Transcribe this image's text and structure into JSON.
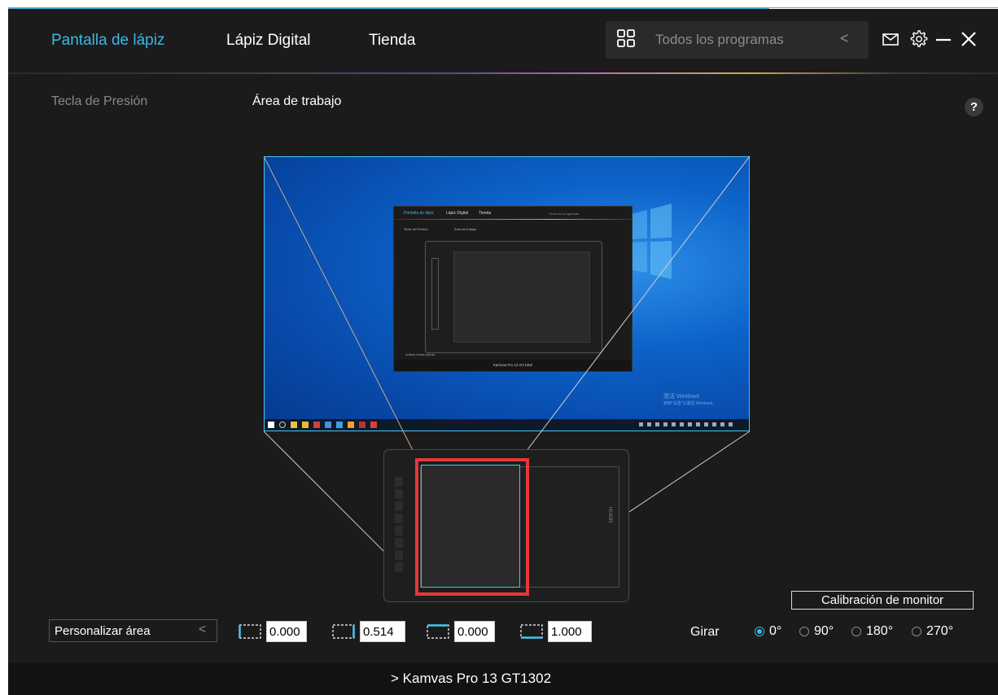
{
  "nav": {
    "items": [
      "Pantalla de lápiz",
      "Lápiz Digital",
      "Tienda"
    ],
    "active_color": "#3ab8e8"
  },
  "programs": {
    "label": "Todos los programas"
  },
  "tabs": {
    "pressure": "Tecla de Presión",
    "work_area": "Área de trabajo"
  },
  "help": "?",
  "preview": {
    "mini_nav": [
      "Pantalla de lápiz",
      "Lápiz Digital",
      "Tienda"
    ],
    "mini_programs": "Todos los programas",
    "mini_tabs": [
      "Tecla de Presión",
      "Área de trabajo"
    ],
    "mini_check": "Activar teclas físicas",
    "mini_footer": "Kamvas Pro 13 GT1302",
    "watermark_line1": "激活 Windows",
    "watermark_line2": "转到\"设置\"以激活 Windows。",
    "brand": "HUION"
  },
  "controls": {
    "calibration": "Calibración de monitor",
    "area_select": "Personalizar área",
    "coords": [
      "0.000",
      "0.514",
      "0.000",
      "1.000"
    ],
    "rotate_label": "Girar",
    "rotations": [
      "0°",
      "90°",
      "180°",
      "270°"
    ],
    "selected_rotation": "0°"
  },
  "footer": {
    "device": "Kamvas Pro 13 GT1302"
  },
  "colors": {
    "highlight": "#e5373a",
    "mapping": "#3fc6f0"
  }
}
